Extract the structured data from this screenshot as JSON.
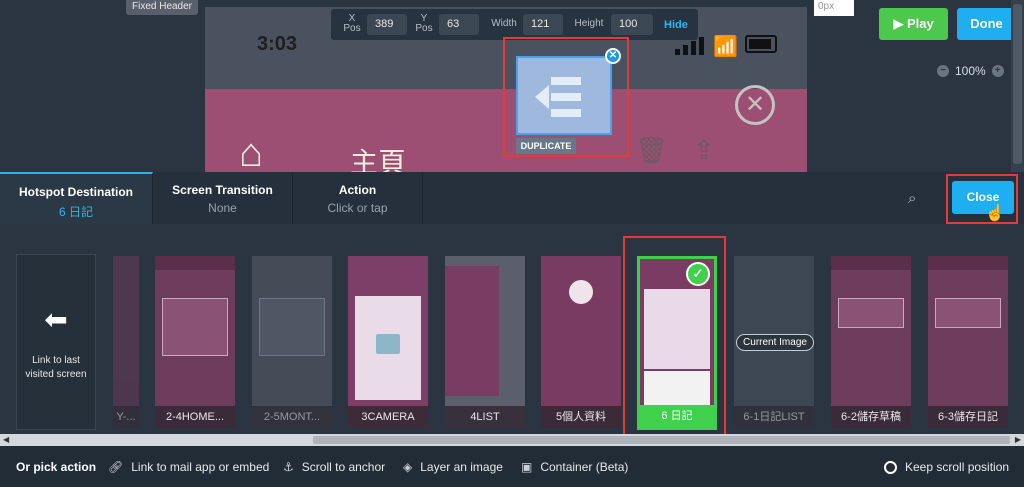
{
  "editor": {
    "fixed_header": "Fixed Header",
    "position_bar": {
      "x_label": "X\nPos",
      "x_value": "389",
      "y_label": "Y\nPos",
      "y_value": "63",
      "width_label": "Width",
      "width_value": "121",
      "height_label": "Height",
      "height_value": "100",
      "hide_label": "Hide"
    },
    "px_input": "0px",
    "play_label": "Play",
    "done_label": "Done",
    "zoom_value": "100%"
  },
  "phone_screen": {
    "time": "3:03",
    "title": "主頁"
  },
  "hotspot": {
    "duplicate_label": "DUPLICATE"
  },
  "tabs": [
    {
      "title": "Hotspot Destination",
      "subtitle": "6 日記"
    },
    {
      "title": "Screen Transition",
      "subtitle": "None"
    },
    {
      "title": "Action",
      "subtitle": "Click or tap"
    }
  ],
  "close_label": "Close",
  "link_last": "Link to last visited screen",
  "screens": [
    {
      "label": "Y-..."
    },
    {
      "label": "2-4HOME..."
    },
    {
      "label": "2-5MONT..."
    },
    {
      "label": "3CAMERA"
    },
    {
      "label": "4LIST"
    },
    {
      "label": "5個人資料"
    },
    {
      "label": "6 日記"
    },
    {
      "label": "6-1日記LIST"
    },
    {
      "label": "6-2儲存草稿"
    },
    {
      "label": "6-3儲存日記"
    }
  ],
  "current_image_label": "Current Image",
  "bottom_bar": {
    "pick_label": "Or pick action",
    "mail_label": "Link to mail app or embed",
    "scroll_label": "Scroll to anchor",
    "layer_label": "Layer an image",
    "container_label": "Container (Beta)",
    "keep_scroll_label": "Keep scroll position"
  }
}
